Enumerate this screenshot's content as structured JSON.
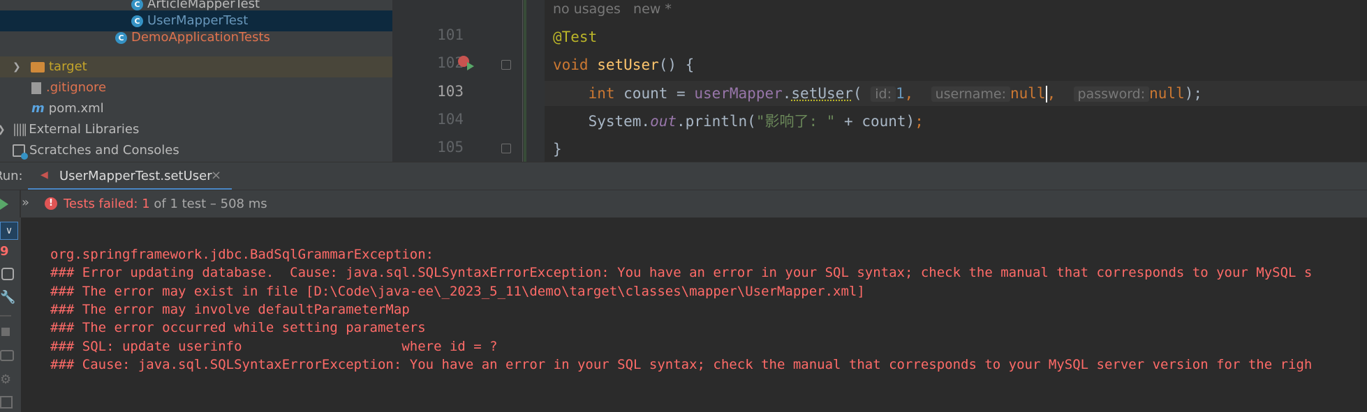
{
  "project_tree": {
    "items": [
      {
        "label": "ArticleMapperTest",
        "kind": "test-class"
      },
      {
        "label": "UserMapperTest",
        "kind": "test-class"
      },
      {
        "label": "DemoApplicationTests",
        "kind": "test-class"
      },
      {
        "label": "target",
        "kind": "folder"
      },
      {
        "label": ".gitignore",
        "kind": "file"
      },
      {
        "label": "pom.xml",
        "kind": "file"
      },
      {
        "label": "External Libraries",
        "kind": "libraries"
      },
      {
        "label": "Scratches and Consoles",
        "kind": "scratches"
      }
    ]
  },
  "editor": {
    "usage_hint": "no usages   new *",
    "line_numbers": [
      "101",
      "102",
      "103",
      "104",
      "105"
    ],
    "current_line": "103",
    "code": {
      "annotation": "@Test",
      "kw_void": "void",
      "method_name": "setUser",
      "sig_rest": "() {",
      "kw_int": "int",
      "var_decl": " count = ",
      "field_mapper": "userMapper",
      "dot": ".",
      "call_name": "setUser",
      "open_paren": "(",
      "hint_id": "id:",
      "arg1": "1",
      "comma": ",",
      "hint_username": "username:",
      "kw_null": "null",
      "hint_password": "password:",
      "close_call": ");",
      "sys_class": "System.",
      "sys_out": "out",
      "println_open": ".println(",
      "string_literal": "\"影响了: \"",
      "concat": " + count)",
      "semicolon": ";",
      "closing_brace": "}"
    }
  },
  "run_panel": {
    "label": "Run:",
    "tab_label": "UserMapperTest.setUser",
    "status_prefix": "Tests failed: ",
    "failed_count": "1",
    "status_suffix": " of 1 test – 508 ms",
    "console_lines": [
      "org.springframework.jdbc.BadSqlGrammarException:",
      "### Error updating database.  Cause: java.sql.SQLSyntaxErrorException: You have an error in your SQL syntax; check the manual that corresponds to your MySQL s",
      "### The error may exist in file [D:\\Code\\java-ee\\_2023_5_11\\demo\\target\\classes\\mapper\\UserMapper.xml]",
      "### The error may involve defaultParameterMap",
      "### The error occurred while setting parameters",
      "### SQL: update userinfo                    where id = ?",
      "### Cause: java.sql.SQLSyntaxErrorException: You have an error in your SQL syntax; check the manual that corresponds to your MySQL server version for the righ"
    ]
  },
  "colors": {
    "panel_bg": "#3c3f41",
    "editor_bg": "#2b2b2b",
    "error_red": "#ff6b68",
    "keyword": "#cc7832"
  }
}
